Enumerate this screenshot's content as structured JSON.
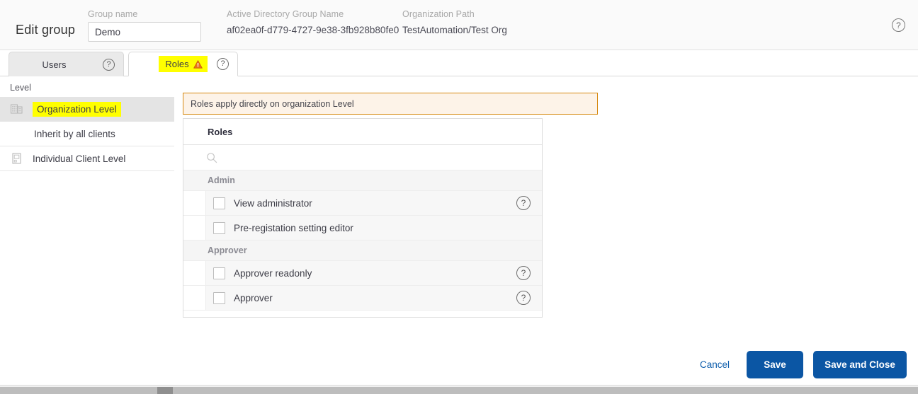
{
  "header": {
    "page_title": "Edit group",
    "group_name": {
      "label": "Group name",
      "value": "Demo",
      "placeholder": ""
    },
    "ad_group_name": {
      "label": "Active Directory Group Name",
      "value": "af02ea0f-d779-4727-9e38-3fb928b80fe0"
    },
    "organization_path": {
      "label": "Organization Path",
      "value": "TestAutomation / Test Org",
      "root": "TestAutomation",
      "separator": "/",
      "leaf": "Test Org"
    },
    "help_icon": "help-circle-icon"
  },
  "tabs": [
    {
      "label": "Users",
      "active": false,
      "help_icon": "help-circle-icon",
      "warning": false
    },
    {
      "label": "Roles",
      "active": true,
      "help_icon": "help-circle-icon",
      "warning": true,
      "warning_icon": "warning-triangle-icon",
      "highlight_color": "#ffff00"
    }
  ],
  "level_panel": {
    "caption": "Level",
    "items": [
      {
        "label": "Organization Level",
        "icon": "building-icon",
        "selected": true,
        "highlighted": true
      },
      {
        "label": "Inherit by all clients",
        "icon": "",
        "selected": false,
        "sub": true
      },
      {
        "label": "Individual Client Level",
        "icon": "client-monitor-icon",
        "selected": false
      }
    ]
  },
  "banner": {
    "text": "Roles apply directly on organization Level",
    "background": "#fdf3e8",
    "border_color": "#d68910"
  },
  "roles_table": {
    "header": "Roles",
    "search": {
      "value": "",
      "placeholder": "",
      "icon": "search-icon"
    },
    "groups": [
      {
        "name": "Admin",
        "rows": [
          {
            "label": "View administrator",
            "checked": false,
            "help_icon": "help-circle-icon",
            "has_help": true
          },
          {
            "label": "Pre-registation setting editor",
            "checked": false,
            "help_icon": "",
            "has_help": false
          }
        ]
      },
      {
        "name": "Approver",
        "rows": [
          {
            "label": "Approver readonly",
            "checked": false,
            "help_icon": "help-circle-icon",
            "has_help": true
          },
          {
            "label": "Approver",
            "checked": false,
            "help_icon": "help-circle-icon",
            "has_help": true
          }
        ]
      }
    ]
  },
  "footer": {
    "cancel_label": "Cancel",
    "save_label": "Save",
    "save_close_label": "Save and Close",
    "primary_color": "#0b56a4",
    "link_color": "#0b5cab"
  },
  "scrollbar": {
    "orientation": "horizontal"
  }
}
